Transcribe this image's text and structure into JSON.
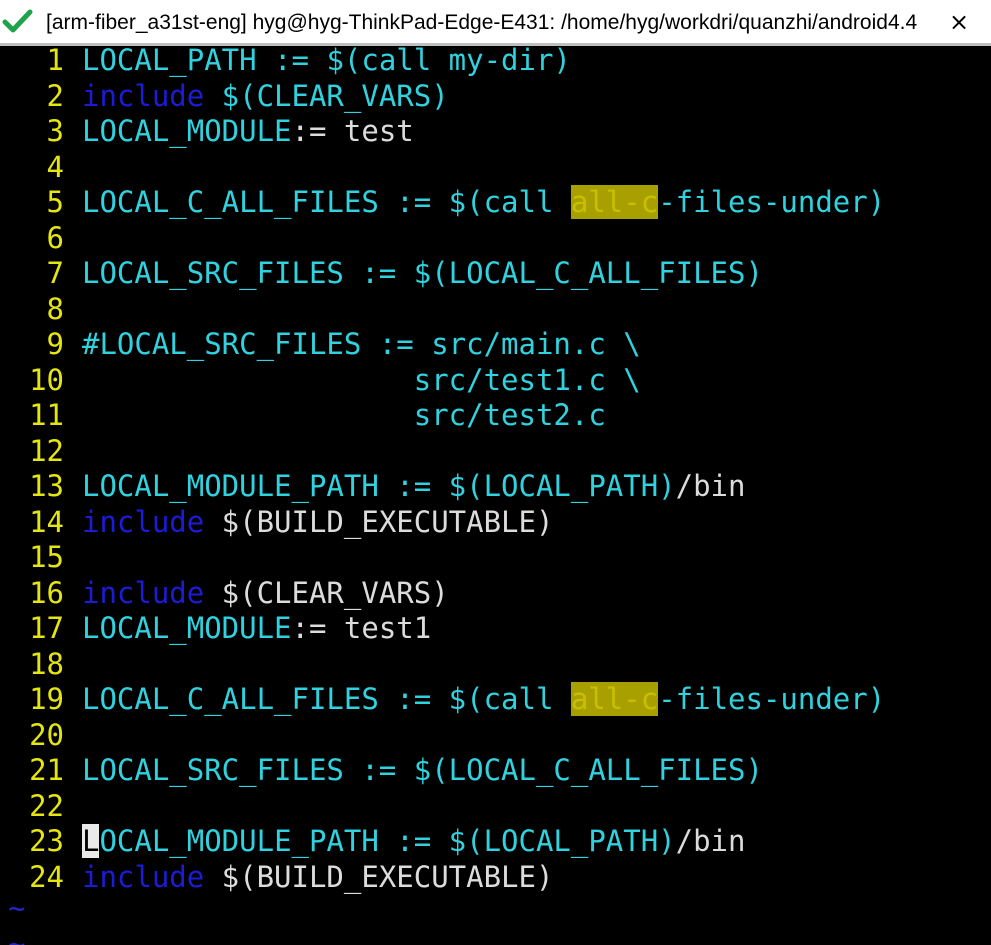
{
  "window": {
    "title": "[arm-fiber_a31st-eng] hyg@hyg-ThinkPad-Edge-E431: /home/hyg/workdri/quanzhi/android4.4",
    "close_label": "×"
  },
  "colors": {
    "background": "#000000",
    "line_number": "#e5e510",
    "text_cyan": "#2fd2de",
    "keyword_blue": "#1b1bd8",
    "text_white": "#dcdcdc",
    "search_highlight": "#a8a000"
  },
  "editor": {
    "lines": [
      {
        "num": "1",
        "segments": [
          [
            "c",
            "LOCAL_PATH := "
          ],
          [
            "c",
            "$(call my-dir)"
          ]
        ]
      },
      {
        "num": "2",
        "segments": [
          [
            "k",
            "include"
          ],
          [
            "c",
            " $(CLEAR_VARS)"
          ]
        ]
      },
      {
        "num": "3",
        "segments": [
          [
            "c",
            "LOCAL_MODULE"
          ],
          [
            "w",
            ":= test"
          ]
        ]
      },
      {
        "num": "4",
        "segments": []
      },
      {
        "num": "5",
        "segments": [
          [
            "c",
            "LOCAL_C_ALL_FILES := $(call "
          ],
          [
            "hl",
            "all-c"
          ],
          [
            "c",
            "-files-under)"
          ]
        ]
      },
      {
        "num": "6",
        "segments": []
      },
      {
        "num": "7",
        "segments": [
          [
            "c",
            "LOCAL_SRC_FILES := $(LOCAL_C_ALL_FILES)"
          ]
        ]
      },
      {
        "num": "8",
        "segments": []
      },
      {
        "num": "9",
        "segments": [
          [
            "c",
            "#LOCAL_SRC_FILES := src/main.c \\"
          ]
        ]
      },
      {
        "num": "10",
        "segments": [
          [
            "c",
            "                   src/test1.c \\"
          ]
        ]
      },
      {
        "num": "11",
        "segments": [
          [
            "c",
            "                   src/test2.c"
          ]
        ]
      },
      {
        "num": "12",
        "segments": []
      },
      {
        "num": "13",
        "segments": [
          [
            "c",
            "LOCAL_MODULE_PATH := $(LOCAL_PATH)"
          ],
          [
            "w",
            "/bin"
          ]
        ]
      },
      {
        "num": "14",
        "segments": [
          [
            "k",
            "include"
          ],
          [
            "w",
            " $(BUILD_EXECUTABLE)"
          ]
        ]
      },
      {
        "num": "15",
        "segments": []
      },
      {
        "num": "16",
        "segments": [
          [
            "k",
            "include"
          ],
          [
            "w",
            " $(CLEAR_VARS)"
          ]
        ]
      },
      {
        "num": "17",
        "segments": [
          [
            "c",
            "LOCAL_MODULE"
          ],
          [
            "w",
            ":= test1"
          ]
        ]
      },
      {
        "num": "18",
        "segments": []
      },
      {
        "num": "19",
        "segments": [
          [
            "c",
            "LOCAL_C_ALL_FILES := $(call "
          ],
          [
            "hl",
            "all-c"
          ],
          [
            "c",
            "-files-under)"
          ]
        ]
      },
      {
        "num": "20",
        "segments": []
      },
      {
        "num": "21",
        "segments": [
          [
            "c",
            "LOCAL_SRC_FILES := $(LOCAL_C_ALL_FILES)"
          ]
        ]
      },
      {
        "num": "22",
        "segments": []
      },
      {
        "num": "23",
        "segments": [
          [
            "cursor",
            "L"
          ],
          [
            "c",
            "OCAL_MODULE_PATH := $(LOCAL_PATH)"
          ],
          [
            "w",
            "/bin"
          ]
        ]
      },
      {
        "num": "24",
        "segments": [
          [
            "k",
            "include"
          ],
          [
            "w",
            " $(BUILD_EXECUTABLE)"
          ]
        ]
      }
    ],
    "tilde_lines": [
      "~",
      "~"
    ]
  }
}
